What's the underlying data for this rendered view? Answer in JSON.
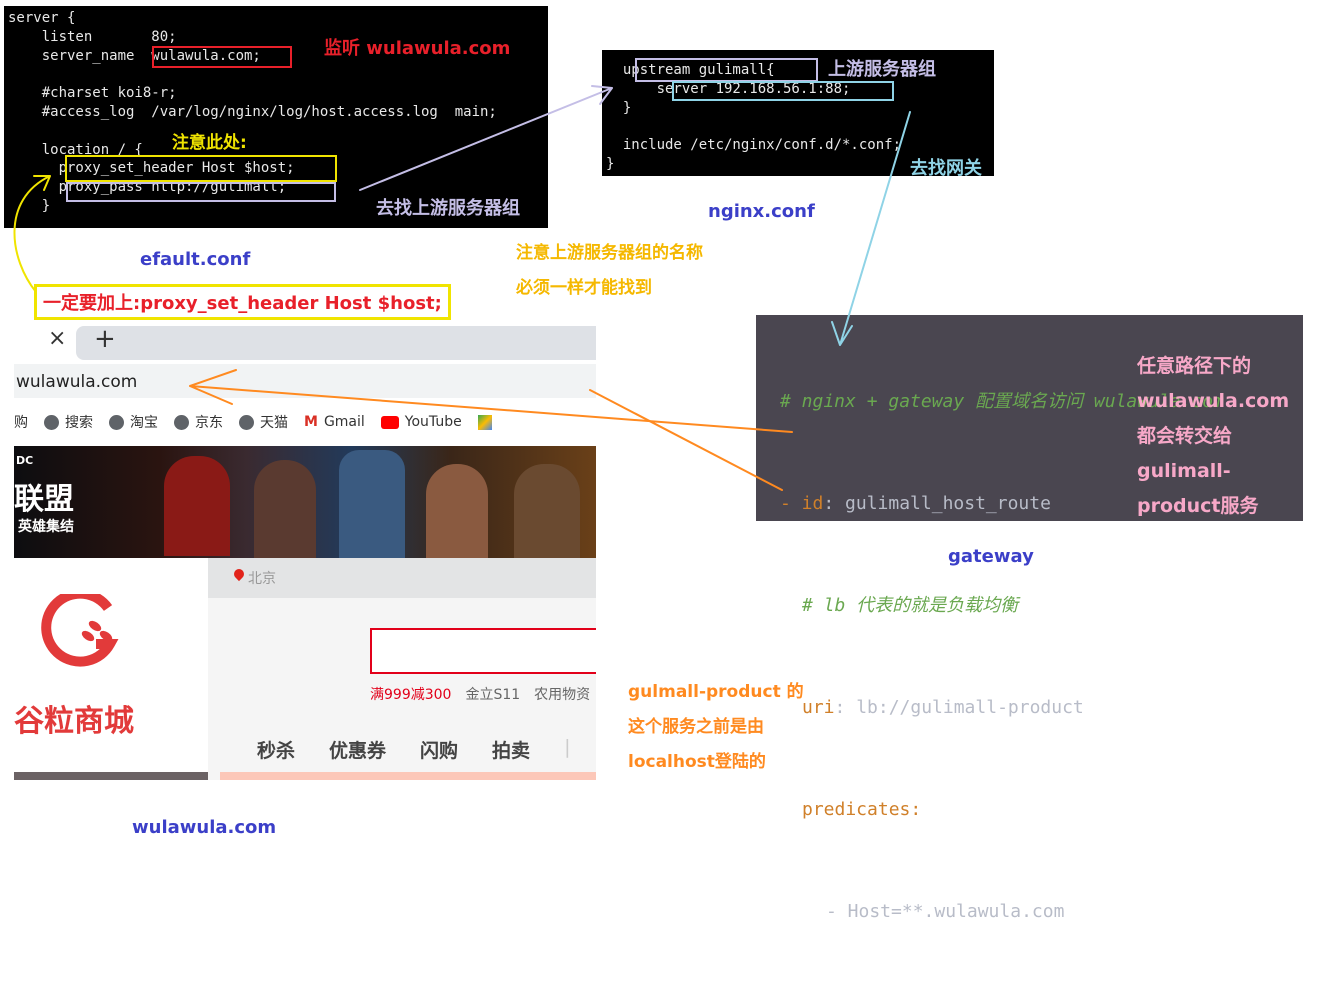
{
  "default_conf": {
    "lines": [
      "server {",
      "    listen       80;",
      "    server_name  wulawula.com;",
      "",
      "    #charset koi8-r;",
      "    #access_log  /var/log/nginx/log/host.access.log  main;",
      "",
      "    location / {",
      "      proxy_set_header Host $host;",
      "      proxy_pass http://gulimall;",
      "    }"
    ],
    "caption": "efault.conf",
    "note_listen": "监听 wulawula.com",
    "note_attention": "注意此处:",
    "note_find_upstream": "去找上游服务器组",
    "note_must_add": "一定要加上:proxy_set_header Host $host;"
  },
  "nginx_conf": {
    "lines": [
      "  upstream gulimall{",
      "      server 192.168.56.1:88;",
      "  }",
      "",
      "  include /etc/nginx/conf.d/*.conf;",
      "}"
    ],
    "caption": "nginx.conf",
    "note_upstream": "上游服务器组",
    "note_find_gateway": "去找网关",
    "note_same_name_1": "注意上游服务器组的名称",
    "note_same_name_2": "必须一样才能找到"
  },
  "gateway": {
    "comment1": "# nginx + gateway 配置域名访问 wulawula.com",
    "id_key": "- id",
    "id_val": ": gulimall_host_route",
    "comment2": "# lb 代表的就是负载均衡",
    "uri_key": "uri",
    "uri_val": ": lb://gulimall-product",
    "pred_key": "predicates:",
    "host_line": "- Host=**.wulawula.com",
    "notes": [
      "任意路径下的",
      "wulawula.com",
      "都会转交给",
      "gulimall-",
      "product服务"
    ],
    "caption": "gateway"
  },
  "browser": {
    "close_tab": "×",
    "new_tab": "+",
    "address": "wulawula.com",
    "bookmarks": [
      "购",
      "搜索",
      "淘宝",
      "京东",
      "天猫",
      "Gmail",
      "YouTube"
    ],
    "banner_title": "联盟",
    "banner_sub": "英雄集结",
    "banner_logo": "DC",
    "location": "北京",
    "logo_text": "谷粒商城",
    "hot_words": [
      "满999减300",
      "金立S11",
      "农用物资"
    ],
    "nav": [
      "秒杀",
      "优惠券",
      "闪购",
      "拍卖"
    ],
    "caption": "wulawula.com"
  },
  "product_note": [
    "gulmall-product 的",
    "这个服务之前是由",
    "localhost登陆的"
  ],
  "colors": {
    "red": "#e8202a",
    "yellow": "#f0e400",
    "lavender": "#c4bee6",
    "cyan": "#8fd3e6",
    "blue": "#3b3fc8",
    "orange": "#ff8a20",
    "gold": "#f5b800",
    "pink": "#f7a8c8"
  }
}
